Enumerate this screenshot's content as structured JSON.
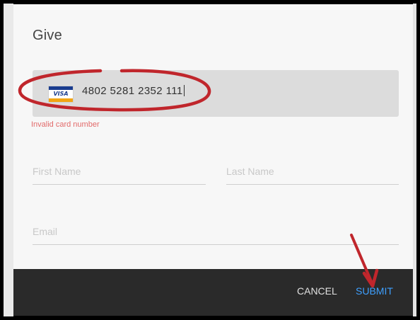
{
  "dialog": {
    "title": "Give"
  },
  "card": {
    "brand": "VISA",
    "number": "4802 5281 2352 111",
    "error": "Invalid card number"
  },
  "form": {
    "first_name_placeholder": "First Name",
    "last_name_placeholder": "Last Name",
    "email_placeholder": "Email"
  },
  "footer": {
    "cancel_label": "CANCEL",
    "submit_label": "SUBMIT"
  },
  "colors": {
    "error": "#e26a6a",
    "submit": "#3ea0ff",
    "annotation": "#c0262c",
    "footer_bg": "#2a2a2a"
  },
  "icons": {
    "card_brand": "visa-card-icon"
  }
}
